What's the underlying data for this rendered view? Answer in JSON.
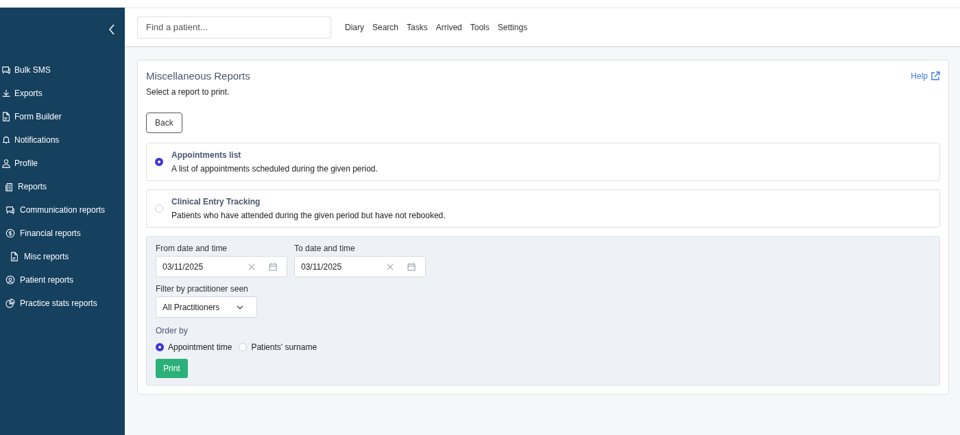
{
  "sidebar": {
    "items": [
      {
        "label": "Bulk SMS",
        "kind": "chat"
      },
      {
        "label": "Exports",
        "kind": "download"
      },
      {
        "label": "Form Builder",
        "kind": "doc"
      },
      {
        "label": "Notifications",
        "kind": "bell"
      },
      {
        "label": "Profile",
        "kind": "person"
      },
      {
        "label": "Reports",
        "kind": "clipboard",
        "children": [
          {
            "label": "Communication reports",
            "kind": "chat"
          },
          {
            "label": "Financial reports",
            "kind": "dollar",
            "children": [
              {
                "label": "Misc reports",
                "kind": "doc"
              }
            ]
          },
          {
            "label": "Patient reports",
            "kind": "usercircle"
          },
          {
            "label": "Practice stats reports",
            "kind": "pie"
          }
        ]
      }
    ]
  },
  "header": {
    "search": {
      "placeholder": "Find a patient..."
    },
    "nav": [
      "Diary",
      "Search",
      "Tasks",
      "Arrived",
      "Tools",
      "Settings"
    ]
  },
  "panel": {
    "title": "Miscellaneous Reports",
    "subtitle": "Select a report to print.",
    "help": "Help",
    "back": "Back",
    "reports": [
      {
        "title": "Appointments list",
        "description": "A list of appointments scheduled during the given period.",
        "selected": true
      },
      {
        "title": "Clinical Entry Tracking",
        "description": "Patients who have attended during the given period but have not rebooked.",
        "selected": false
      }
    ],
    "options": {
      "from": {
        "label": "From date and time",
        "value": "03/11/2025"
      },
      "to": {
        "label": "To date and time",
        "value": "03/11/2025"
      },
      "filter": {
        "label": "Filter by practitioner seen",
        "value": "All Practitioners"
      },
      "order": {
        "label": "Order by",
        "choices": [
          {
            "label": "Appointment time",
            "selected": true
          },
          {
            "label": "Patients' surname",
            "selected": false
          }
        ]
      },
      "print": "Print"
    }
  }
}
